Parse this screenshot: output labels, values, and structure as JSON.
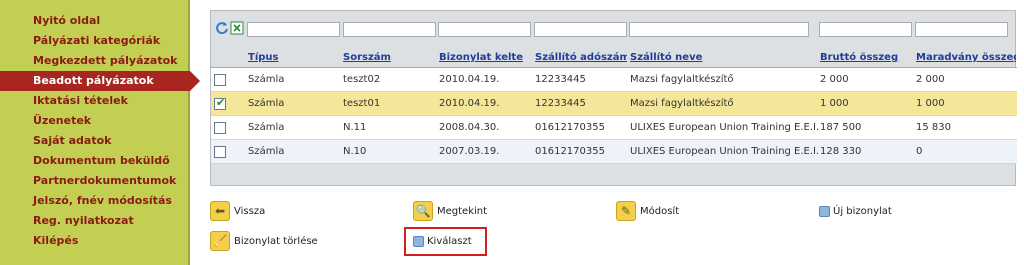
{
  "sidebar": {
    "items": [
      {
        "label": "Nyitó oldal",
        "active": false
      },
      {
        "label": "Pályázati kategóriák",
        "active": false
      },
      {
        "label": "Megkezdett pályázatok",
        "active": false
      },
      {
        "label": "Beadott pályázatok",
        "active": true
      },
      {
        "label": "Iktatási tételek",
        "active": false
      },
      {
        "label": "Üzenetek",
        "active": false
      },
      {
        "label": "Saját adatok",
        "active": false
      },
      {
        "label": "Dokumentum beküldő",
        "active": false
      },
      {
        "label": "Partnerdokumentumok",
        "active": false
      },
      {
        "label": "Jelszó, fnév módosítás",
        "active": false
      },
      {
        "label": "Reg. nyilatkozat",
        "active": false
      },
      {
        "label": "Kilépés",
        "active": false
      }
    ]
  },
  "toolbar": {
    "icons": [
      "refresh-icon",
      "excel-icon"
    ]
  },
  "table": {
    "headers": [
      "Típus",
      "Sorszám",
      "Bizonylat kelte",
      "Szállító adószáma",
      "Szállító neve",
      "Bruttó összeg",
      "Maradvány összeg"
    ],
    "rows": [
      {
        "checked": false,
        "cells": [
          "Számla",
          "teszt02",
          "2010.04.19.",
          "12233445",
          "Mazsi fagylaltkészítő",
          "2 000",
          "2 000"
        ]
      },
      {
        "checked": true,
        "cells": [
          "Számla",
          "teszt01",
          "2010.04.19.",
          "12233445",
          "Mazsi fagylaltkészítő",
          "1 000",
          "1 000"
        ]
      },
      {
        "checked": false,
        "cells": [
          "Számla",
          "N.11",
          "2008.04.30.",
          "01612170355",
          "ULIXES European Union Training E.E.I.G",
          "187 500",
          "15 830"
        ]
      },
      {
        "checked": false,
        "cells": [
          "Számla",
          "N.10",
          "2007.03.19.",
          "01612170355",
          "ULIXES European Union Training E.E.I.G",
          "128 330",
          "0"
        ]
      }
    ]
  },
  "actions": {
    "back": "Vissza",
    "view": "Megtekint",
    "modify": "Módosít",
    "new_doc": "Új bizonylat",
    "delete_doc": "Bizonylat törlése",
    "select": "Kiválaszt"
  },
  "colors": {
    "sidebar_bg": "#c3cf53",
    "active_item": "#a82520",
    "selected_row": "#f5e79a",
    "highlight_border": "#d41d1d"
  }
}
